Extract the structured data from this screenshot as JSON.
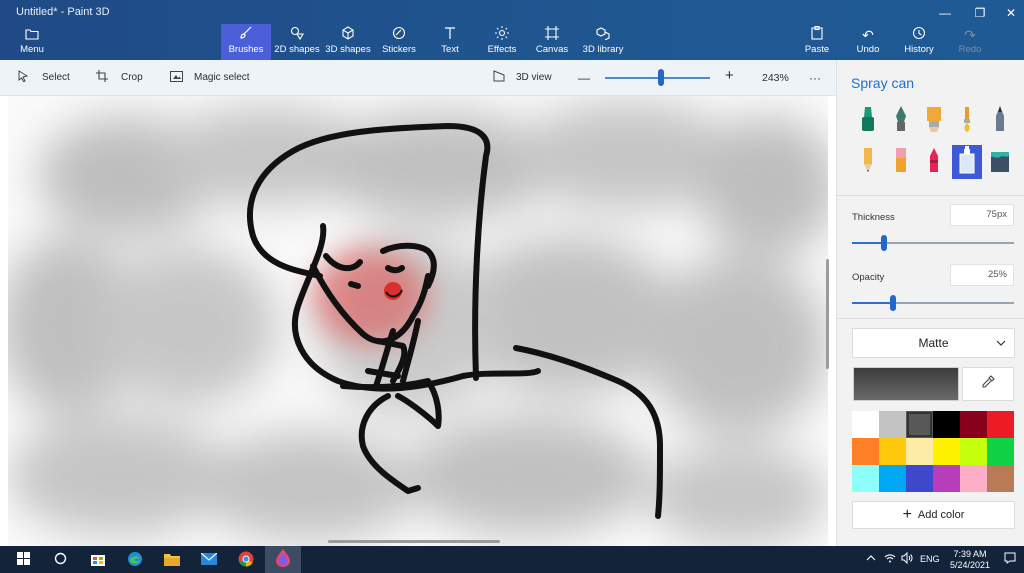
{
  "window": {
    "title": "Untitled* - Paint 3D"
  },
  "ribbon": {
    "menu": {
      "label": "Menu",
      "icon": "folder-icon"
    },
    "tabs": [
      {
        "label": "Brushes",
        "icon": "brush-icon",
        "active": true
      },
      {
        "label": "2D shapes",
        "icon": "2d-shapes-icon"
      },
      {
        "label": "3D shapes",
        "icon": "cube-icon"
      },
      {
        "label": "Stickers",
        "icon": "sticker-icon"
      },
      {
        "label": "Text",
        "icon": "text-icon"
      },
      {
        "label": "Effects",
        "icon": "sun-icon"
      },
      {
        "label": "Canvas",
        "icon": "canvas-icon"
      },
      {
        "label": "3D library",
        "icon": "library-icon"
      }
    ],
    "actions": [
      {
        "label": "Paste",
        "icon": "clipboard-icon"
      },
      {
        "label": "Undo",
        "icon": "undo-icon"
      },
      {
        "label": "History",
        "icon": "history-icon"
      },
      {
        "label": "Redo",
        "icon": "redo-icon",
        "disabled": true
      }
    ]
  },
  "commandbar": {
    "select": "Select",
    "crop": "Crop",
    "magic_select": "Magic select",
    "view3d": "3D view",
    "zoom_minus": "—",
    "zoom_plus": "+",
    "zoom_level": "243%",
    "more": "···",
    "zoom_slider_fraction": 0.52
  },
  "panel": {
    "title": "Spray can",
    "tools": [
      "marker-icon",
      "calligraphy-pen-icon",
      "oil-brush-icon",
      "watercolor-icon",
      "pixel-pen-icon",
      "pencil-icon",
      "eraser-icon",
      "crayon-icon",
      "spray-can-icon",
      "fill-icon"
    ],
    "active_tool": "spray-can-icon",
    "thickness": {
      "label": "Thickness",
      "value": "75px",
      "fraction": 0.2
    },
    "opacity": {
      "label": "Opacity",
      "value": "25%",
      "fraction": 0.25
    },
    "finish": "Matte",
    "add_color": "Add color",
    "palette": [
      "#ffffff",
      "#c3c3c3",
      "#585858",
      "#000000",
      "#88001b",
      "#ec1c24",
      "#ff7f27",
      "#ffc90e",
      "#fdeca6",
      "#fff200",
      "#c4ff0e",
      "#0ed145",
      "#8cfffb",
      "#00a8f3",
      "#3f48cc",
      "#b83dba",
      "#ffaec8",
      "#b97a56"
    ],
    "selected_swatch": 2
  },
  "taskbar": {
    "time": "7:39 AM",
    "date": "5/24/2021",
    "language": "ENG"
  }
}
